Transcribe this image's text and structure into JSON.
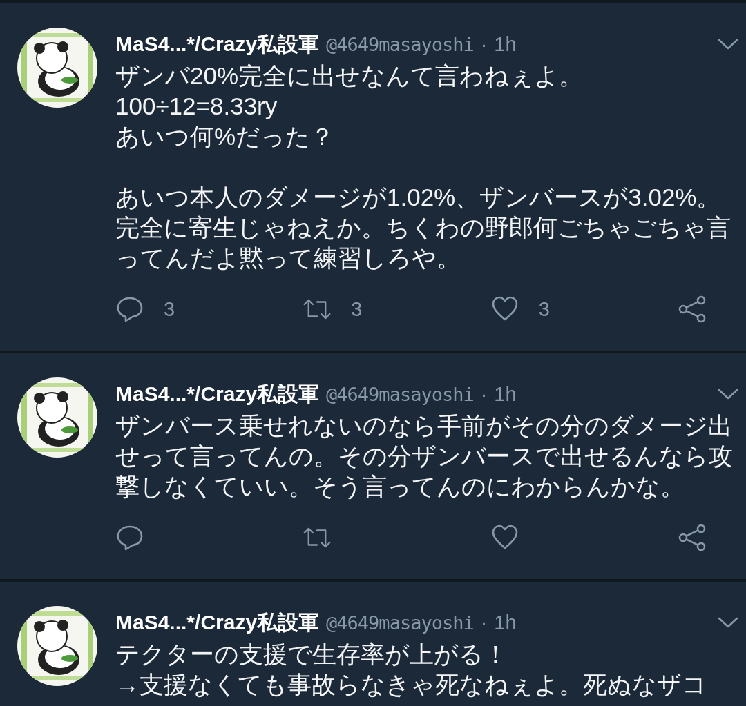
{
  "tweets": [
    {
      "name": "MaS4...*/Crazy私設軍",
      "handle": "@4649masayoshi",
      "separator": "·",
      "time": "1h",
      "avatar": {
        "kind": "picture"
      },
      "paragraphs": [
        "ザンバ20%完全に出せなんて言わねぇよ。\n100÷12=8.33ry\nあいつ何%だった？",
        "あいつ本人のダメージが1.02%、ザンバースが3.02%。完全に寄生じゃねえか。ちくわの野郎何ごちゃごちゃ言ってんだよ黙って練習しろや。"
      ],
      "action_bar": true,
      "counts": {
        "replies": "3",
        "retweets": "3",
        "likes": "3"
      }
    },
    {
      "name": "MaS4...*/Crazy私設軍",
      "handle": "@4649masayoshi",
      "separator": "·",
      "time": "1h",
      "avatar": {
        "kind": "picture"
      },
      "paragraphs": [
        "ザンバース乗せれないのなら手前がその分のダメージ出せって言ってんの。その分ザンバースで出せるんなら攻撃しなくていい。そう言ってんのにわからんかな。"
      ],
      "action_bar": true
    },
    {
      "name": "MaS4...*/Crazy私設軍",
      "handle": "@4649masayoshi",
      "separator": "·",
      "time": "1h",
      "avatar": {
        "kind": "picture"
      },
      "paragraphs": [
        "テクターの支援で生存率が上がる！\n→支援なくても事故らなきゃ死なねぇよ。死ぬなザコ"
      ],
      "action_bar": false
    }
  ]
}
